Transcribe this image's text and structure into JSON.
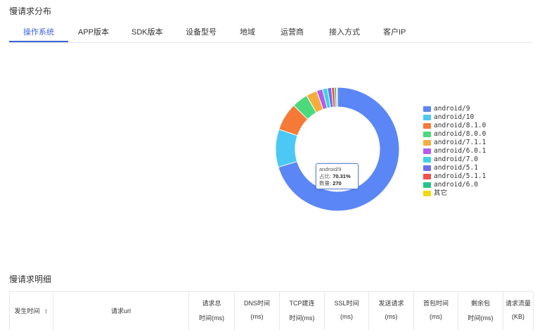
{
  "sections": {
    "distribution_title": "慢请求分布",
    "detail_title": "慢请求明细"
  },
  "tabs": [
    {
      "label": "操作系统",
      "active": true
    },
    {
      "label": "APP版本"
    },
    {
      "label": "SDK版本"
    },
    {
      "label": "设备型号"
    },
    {
      "label": "地域"
    },
    {
      "label": "运营商"
    },
    {
      "label": "接入方式"
    },
    {
      "label": "客户IP"
    }
  ],
  "chart_data": {
    "type": "pie",
    "donut": true,
    "legend_position": "right",
    "categories": [
      "android/9",
      "android/10",
      "android/8.1.0",
      "android/8.0.0",
      "android/7.1.1",
      "android/6.0.1",
      "android/7.0",
      "android/5.1",
      "android/5.1.1",
      "android/6.0",
      "其它"
    ],
    "values": [
      270,
      38,
      28,
      16,
      11,
      6,
      5,
      4,
      3,
      2,
      1
    ],
    "colors": [
      "#5b86f5",
      "#4cc8f5",
      "#f57a38",
      "#4cd97b",
      "#f5ad3d",
      "#b35cf0",
      "#3ed3e0",
      "#6b6ef0",
      "#f5504a",
      "#24c48a",
      "#f2d80e"
    ],
    "tooltip": {
      "label": "android/9",
      "ratio_label": "占比:",
      "ratio": "70.31%",
      "count_label": "数量:",
      "count": "270"
    }
  },
  "table": {
    "columns": [
      {
        "l1": "发生时间",
        "sortable": true
      },
      {
        "l1": "请求url"
      },
      {
        "l1": "请求总",
        "l2": "时间(ms)"
      },
      {
        "l1": "DNS时间",
        "l2": "(ms)"
      },
      {
        "l1": "TCP建连",
        "l2": "时间(ms)"
      },
      {
        "l1": "SSL时间",
        "l2": "(ms)"
      },
      {
        "l1": "发送请求",
        "l2": "(ms)"
      },
      {
        "l1": "首包时间",
        "l2": "(ms)"
      },
      {
        "l1": "剩余包",
        "l2": "时间(ms)"
      },
      {
        "l1": "请求流量",
        "l2": "(KB)"
      }
    ]
  }
}
